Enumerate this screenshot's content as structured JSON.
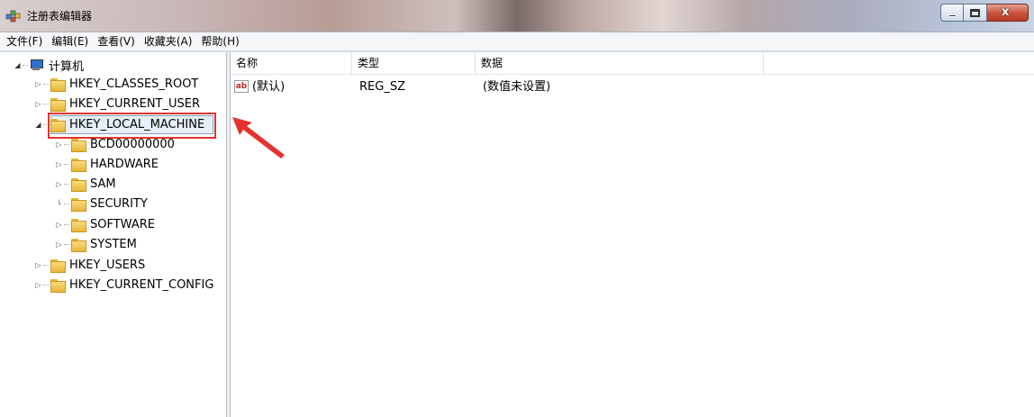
{
  "window": {
    "title": "注册表编辑器",
    "controls": {
      "minimize": "–",
      "maximize": "□",
      "close": "x"
    }
  },
  "menu": [
    {
      "label": "文件(F)"
    },
    {
      "label": "编辑(E)"
    },
    {
      "label": "查看(V)"
    },
    {
      "label": "收藏夹(A)"
    },
    {
      "label": "帮助(H)"
    }
  ],
  "tree": {
    "root": "计算机",
    "items": [
      {
        "label": "HKEY_CLASSES_ROOT"
      },
      {
        "label": "HKEY_CURRENT_USER"
      },
      {
        "label": "HKEY_LOCAL_MACHINE",
        "selected": true
      },
      {
        "label": "BCD00000000"
      },
      {
        "label": "HARDWARE"
      },
      {
        "label": "SAM"
      },
      {
        "label": "SECURITY"
      },
      {
        "label": "SOFTWARE"
      },
      {
        "label": "SYSTEM"
      },
      {
        "label": "HKEY_USERS"
      },
      {
        "label": "HKEY_CURRENT_CONFIG"
      }
    ]
  },
  "list": {
    "columns": [
      "名称",
      "类型",
      "数据"
    ],
    "rows": [
      {
        "name": "(默认)",
        "type": "REG_SZ",
        "data": "(数值未设置)"
      }
    ]
  },
  "colors": {
    "highlight_border": "#e4332e",
    "arrow": "#e4332e",
    "selection_fill": "#e7f0fa"
  }
}
